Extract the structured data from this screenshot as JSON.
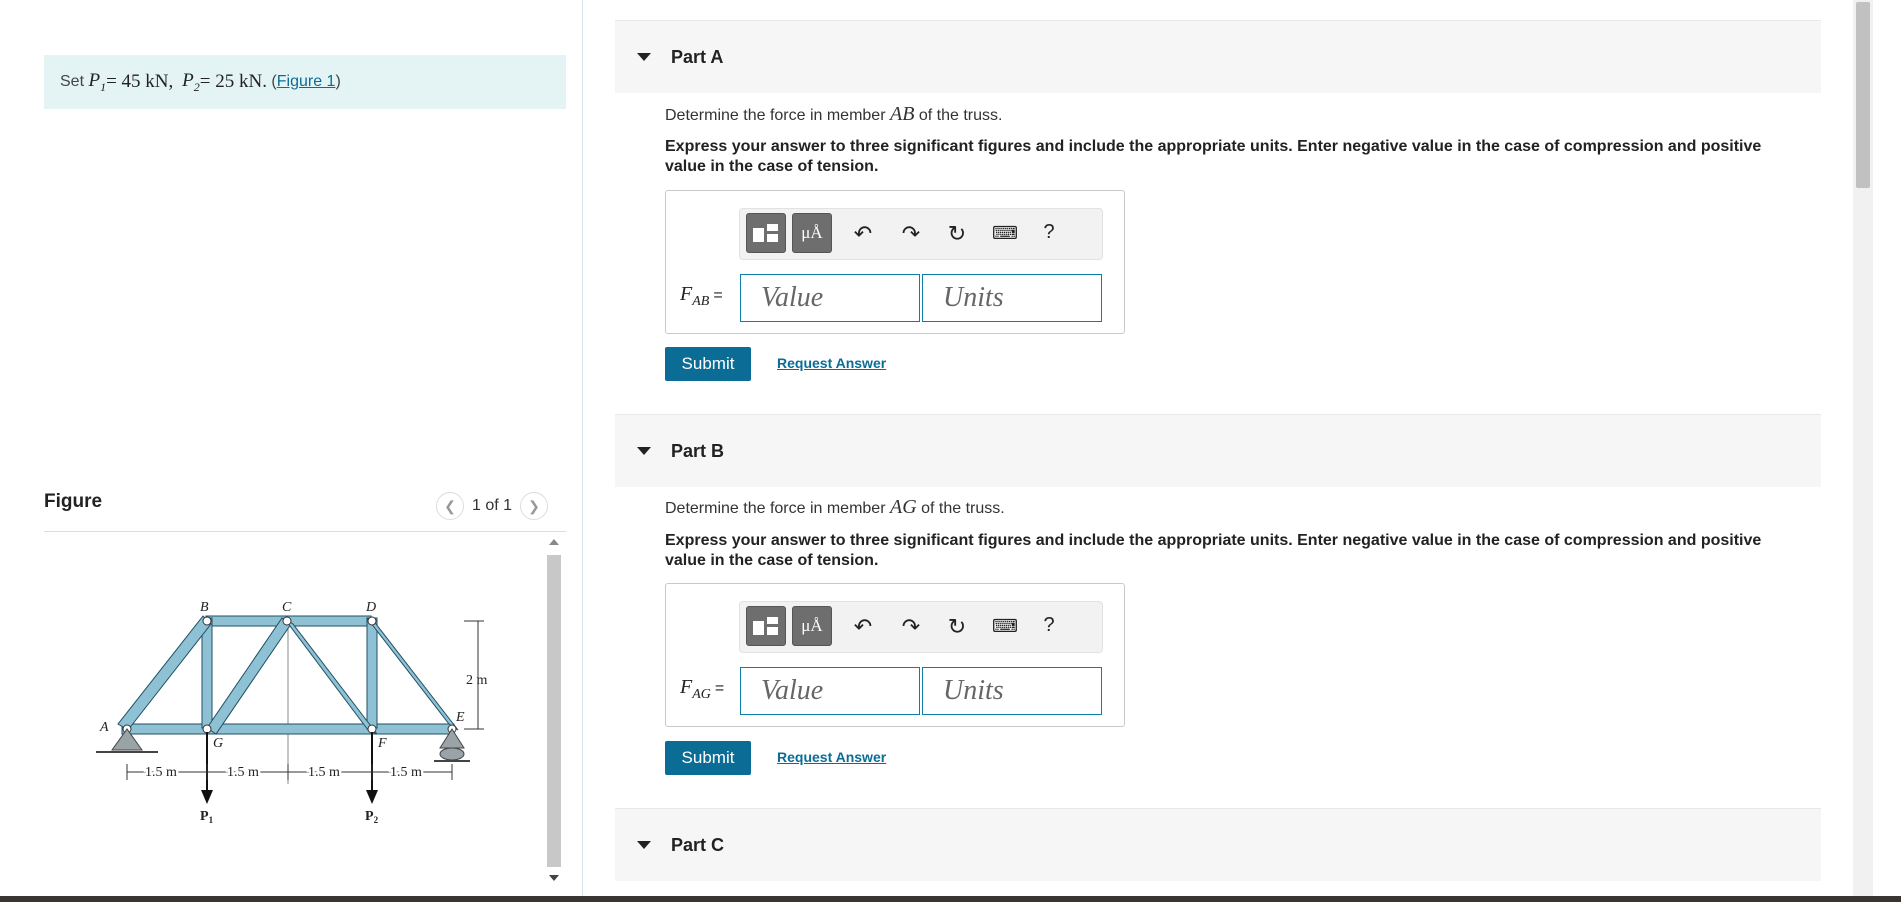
{
  "problem": {
    "set_prefix": "Set",
    "p1_sym": "P",
    "p1_sub": "1",
    "p1_eq": " = 45 kN,",
    "p2_sym": "P",
    "p2_sub": "2",
    "p2_eq": " = 25 kN.",
    "fig_link_open": "(",
    "fig_link": "Figure 1",
    "fig_link_close": ")"
  },
  "figure": {
    "title": "Figure",
    "pager": "1 of 1",
    "labels": {
      "A": "A",
      "B": "B",
      "C": "C",
      "D": "D",
      "E": "E",
      "F": "F",
      "G": "G",
      "height": "2 m",
      "span1": "1.5 m",
      "span2": "1.5 m",
      "span3": "1.5 m",
      "span4": "1.5 m",
      "P1": "P",
      "P1_sub": "1",
      "P2": "P",
      "P2_sub": "2"
    }
  },
  "parts": [
    {
      "title": "Part A",
      "question_prefix": "Determine the force in member ",
      "member": "AB",
      "question_suffix": " of the truss.",
      "instructions": "Express your answer to three significant figures and include the appropriate units. Enter negative value in the case of compression and positive value in the case of tension.",
      "label_main": "F",
      "label_sub": "AB",
      "value_placeholder": "Value",
      "units_placeholder": "Units",
      "submit": "Submit",
      "request": "Request Answer"
    },
    {
      "title": "Part B",
      "question_prefix": "Determine the force in member ",
      "member": "AG",
      "question_suffix": " of the truss.",
      "instructions": "Express your answer to three significant figures and include the appropriate units. Enter negative value in the case of compression and positive value in the case of tension.",
      "label_main": "F",
      "label_sub": "AG",
      "value_placeholder": "Value",
      "units_placeholder": "Units",
      "submit": "Submit",
      "request": "Request Answer"
    },
    {
      "title": "Part C"
    }
  ],
  "toolbar": {
    "mu_label": "μÅ",
    "help": "?"
  },
  "icons": [
    "templates-icon",
    "units-icon",
    "undo-icon",
    "redo-icon",
    "reset-icon",
    "keyboard-icon",
    "help-icon",
    "caret-down-icon",
    "chevron-left-icon",
    "chevron-right-icon"
  ]
}
